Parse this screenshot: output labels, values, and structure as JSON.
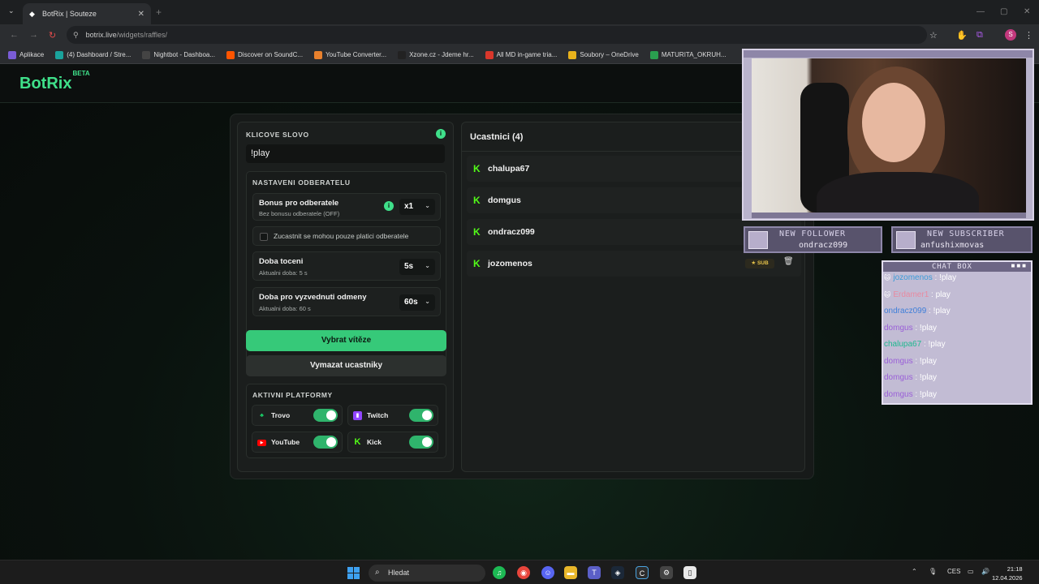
{
  "browser": {
    "tab_title": "BotRix | Souteze",
    "url_host": "botrix.live",
    "url_path": "/widgets/raffles/",
    "profile_initial": "S",
    "bookmarks": [
      {
        "label": "Aplikace",
        "icon": "apps-icon",
        "color": "#7a5cd6"
      },
      {
        "label": "(4) Dashboard / Stre...",
        "icon": "dashboard-icon",
        "color": "#1aa39c"
      },
      {
        "label": "Nightbot - Dashboa...",
        "icon": "nightbot-icon",
        "color": "#444444"
      },
      {
        "label": "Discover on SoundC...",
        "icon": "soundcloud-icon",
        "color": "#ff5500"
      },
      {
        "label": "YouTube Converter...",
        "icon": "converter-icon",
        "color": "#e8812d"
      },
      {
        "label": "Xzone.cz - Jdeme hr...",
        "icon": "xzone-icon",
        "color": "#222222"
      },
      {
        "label": "All MD in-game tria...",
        "icon": "md-icon",
        "color": "#d9372b"
      },
      {
        "label": "Soubory – OneDrive",
        "icon": "onedrive-icon",
        "color": "#e8b21c"
      },
      {
        "label": "MATURITA_OKRUH...",
        "icon": "drive-icon",
        "color": "#2a9f4f"
      }
    ]
  },
  "app": {
    "logo": "BotRix",
    "logo_badge": "BETA",
    "accent": "#3fe08a"
  },
  "settings": {
    "keyword_title": "KLICOVE SLOVO",
    "keyword_value": "!play",
    "subscriber_title": "NASTAVENI ODBERATELU",
    "bonus_label": "Bonus pro odberatele",
    "bonus_sub": "Bez bonusu odberatele (OFF)",
    "bonus_value": "x1",
    "only_paid_label": "Zucastnit se mohou pouze platici odberatele",
    "spin_label": "Doba toceni",
    "spin_sub": "Aktualni doba: 5 s",
    "spin_value": "5s",
    "claim_label": "Doba pro vyzvednuti odmeny",
    "claim_sub": "Aktualni doba: 60 s",
    "claim_value": "60s",
    "pick_winner": "Vybrat vítěze",
    "clear_participants": "Vymazat ucastniky",
    "platforms_title": "AKTIVNI PLATFORMY",
    "platforms": [
      {
        "name": "Trovo",
        "icon": "trovo-icon",
        "color": "#19d66b",
        "enabled": true
      },
      {
        "name": "Twitch",
        "icon": "twitch-icon",
        "color": "#9146ff",
        "enabled": true
      },
      {
        "name": "YouTube",
        "icon": "youtube-icon",
        "color": "#ff0000",
        "enabled": true
      },
      {
        "name": "Kick",
        "icon": "kick-icon",
        "color": "#53fc18",
        "enabled": true
      }
    ]
  },
  "participants": {
    "title": "Ucastnici (4)",
    "list": [
      {
        "name": "chalupa67"
      },
      {
        "name": "domgus"
      },
      {
        "name": "ondracz099"
      },
      {
        "name": "jozomenos",
        "badge": "SUB"
      }
    ]
  },
  "overlay": {
    "new_follower_title": "NEW FOLLOWER",
    "new_follower_name": "ondracz099",
    "new_subscriber_title": "NEW SUBSCRIBER",
    "new_subscriber_name": "anfushixmovas",
    "chat_title": "CHAT BOX",
    "chat": [
      {
        "user": "jozomenos",
        "msg": ": !play",
        "color": "#3a9bd8"
      },
      {
        "user": "Erdamer1",
        "msg": ": play",
        "color": "#e88aa0"
      },
      {
        "user": "ondracz099",
        "msg": ": !play",
        "color": "#3f7fd9"
      },
      {
        "user": "domgus",
        "msg": ": !play",
        "color": "#9a5fd8"
      },
      {
        "user": "chalupa67",
        "msg": ": !play",
        "color": "#1fb88f"
      },
      {
        "user": "domgus",
        "msg": ": !play",
        "color": "#9a5fd8"
      },
      {
        "user": "domgus",
        "msg": ": !play",
        "color": "#9a5fd8"
      },
      {
        "user": "domgus",
        "msg": ": !play",
        "color": "#9a5fd8"
      }
    ]
  },
  "taskbar": {
    "search_placeholder": "Hledat",
    "lang": "CES",
    "time": "21:18",
    "date": "12.04.2026",
    "discord_badge": "99+"
  }
}
